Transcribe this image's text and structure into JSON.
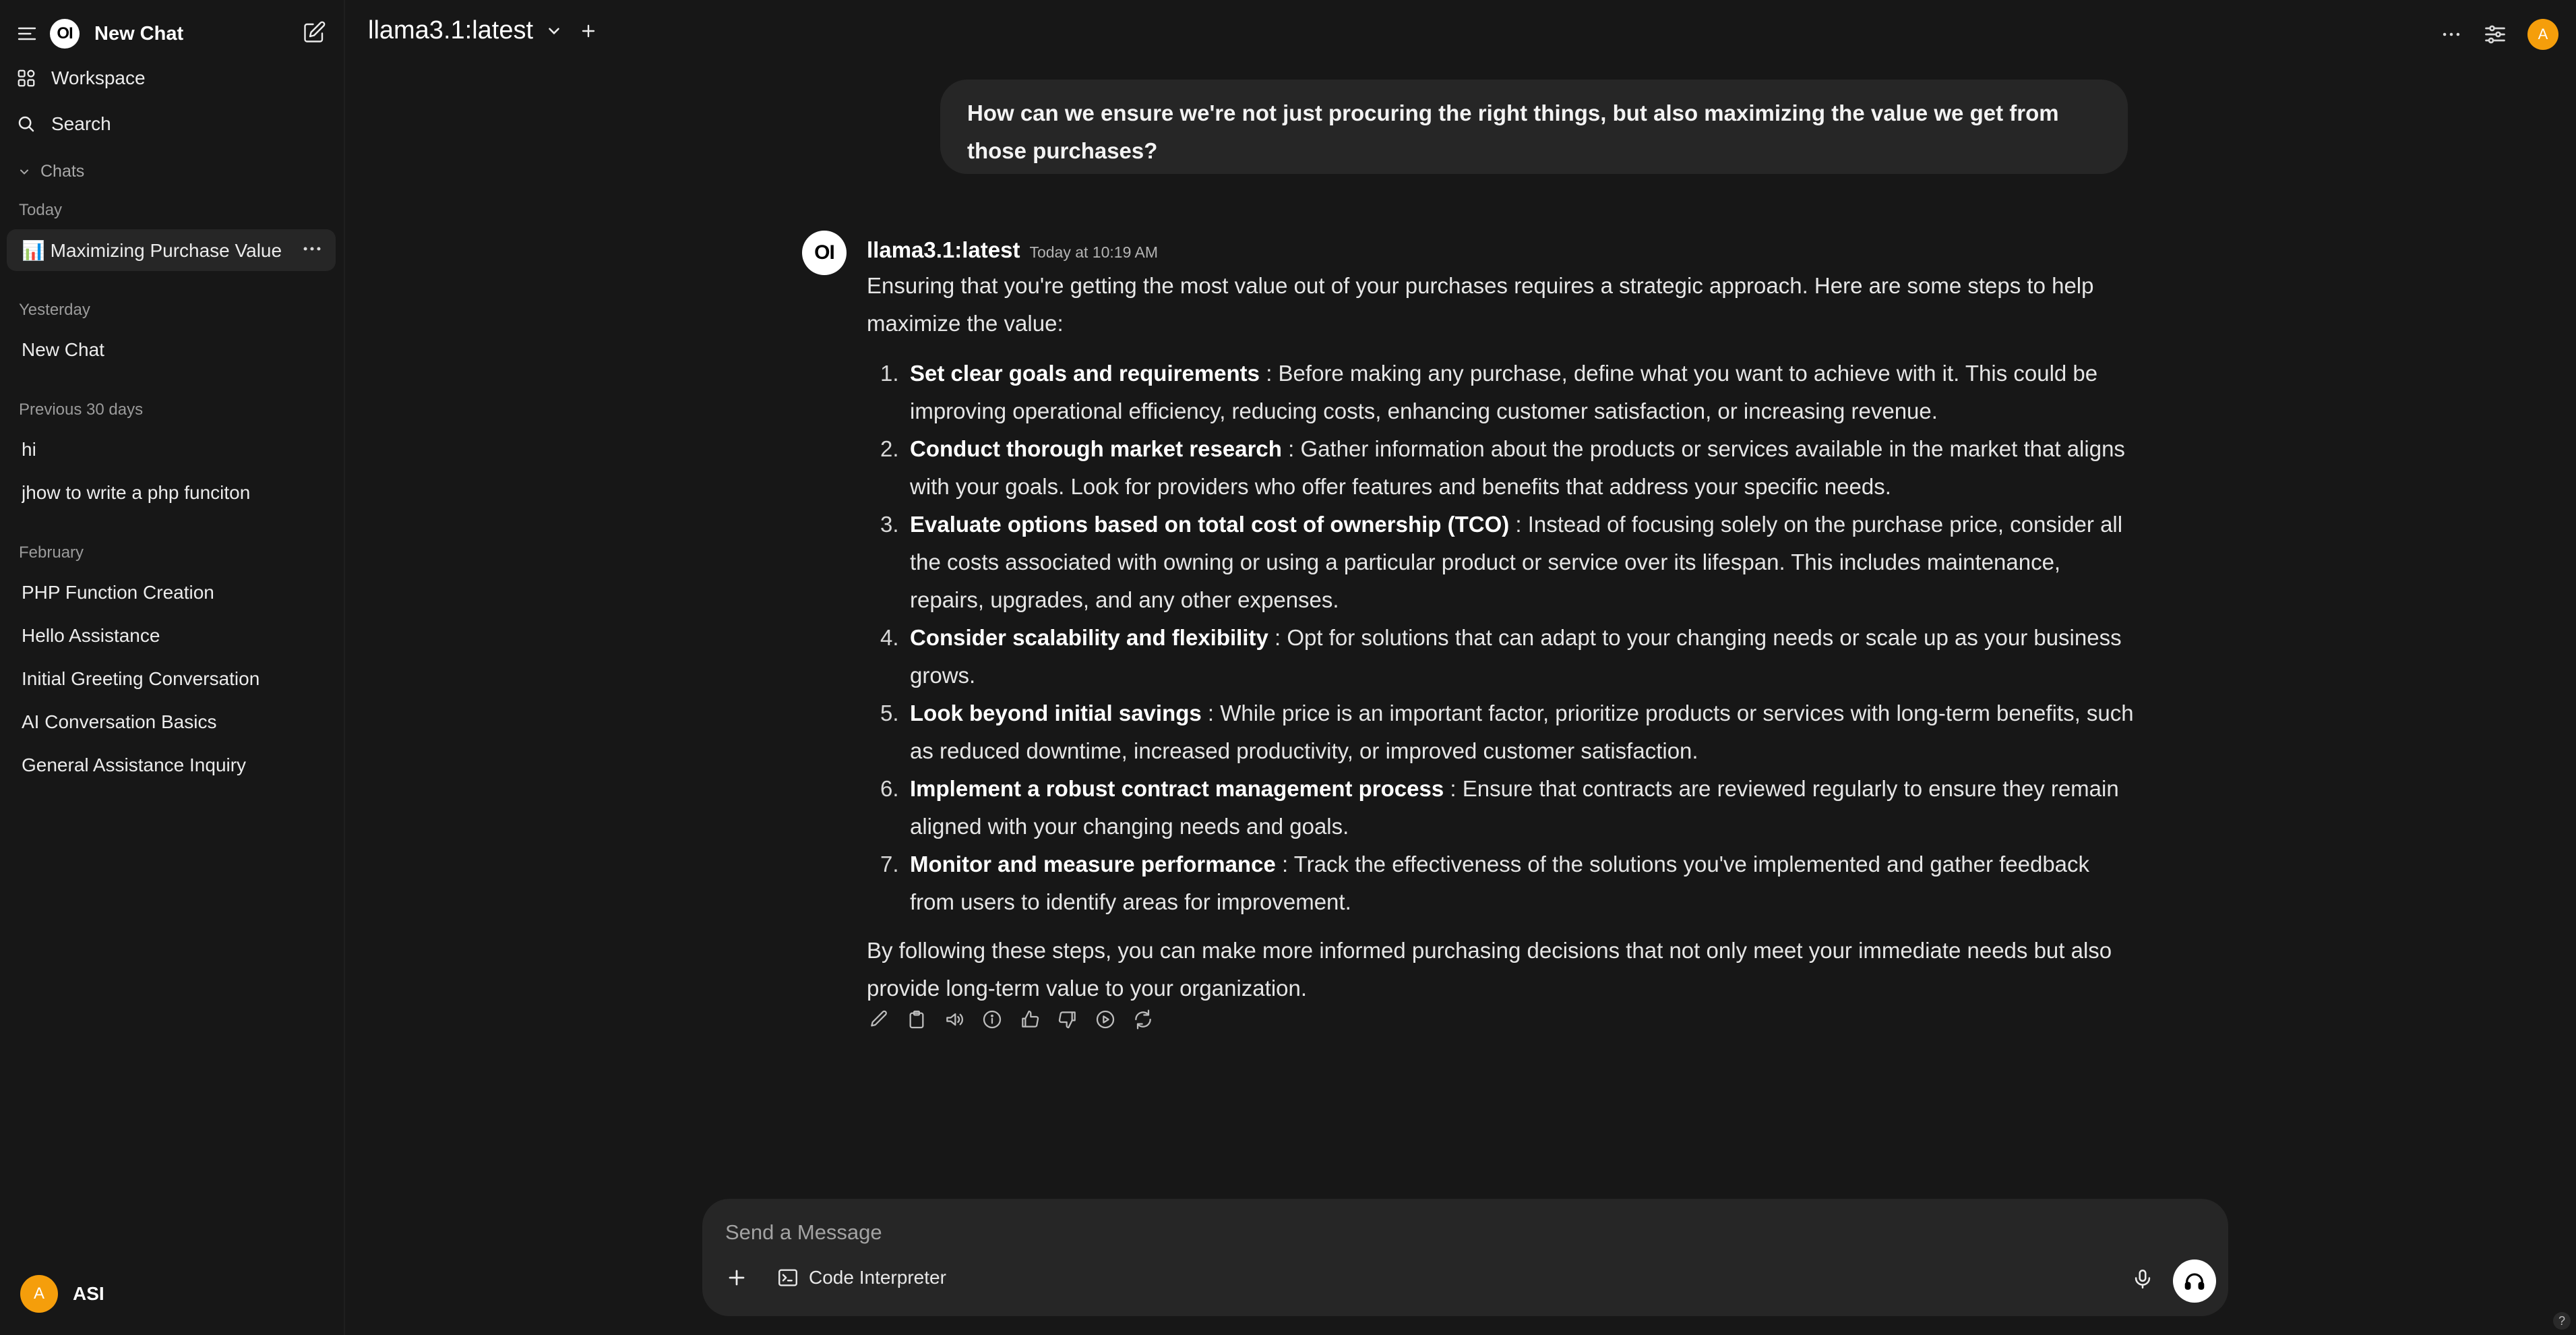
{
  "sidebar": {
    "new_chat_label": "New Chat",
    "workspace_label": "Workspace",
    "search_label": "Search",
    "chats_label": "Chats",
    "sections": {
      "today": "Today",
      "yesterday": "Yesterday",
      "previous_30": "Previous 30 days",
      "february": "February"
    },
    "today_items": [
      {
        "label": "📊 Maximizing Purchase Value"
      }
    ],
    "yesterday_items": [
      {
        "label": "New Chat"
      }
    ],
    "previous_30_items": [
      {
        "label": "hi"
      },
      {
        "label": "jhow to write a php funciton"
      }
    ],
    "february_items": [
      {
        "label": "PHP Function Creation"
      },
      {
        "label": "Hello Assistance"
      },
      {
        "label": "Initial Greeting Conversation"
      },
      {
        "label": "AI Conversation Basics"
      },
      {
        "label": "General Assistance Inquiry"
      }
    ],
    "user": {
      "initial": "A",
      "name": "ASI"
    },
    "brand_logo_text": "OI"
  },
  "header": {
    "model": "llama3.1:latest",
    "avatar_initial": "A"
  },
  "conversation": {
    "user_message": "How can we ensure we're not just procuring the right things, but also maximizing the value we get from those purchases?",
    "assistant": {
      "avatar_text": "OI",
      "model": "llama3.1:latest",
      "time": "Today at 10:19 AM",
      "intro": "Ensuring that you're getting the most value out of your purchases requires a strategic approach. Here are some steps to help maximize the value:",
      "steps": [
        {
          "num": "1.",
          "title": "Set clear goals and requirements",
          "text": " : Before making any purchase, define what you want to achieve with it. This could be improving operational efficiency, reducing costs, enhancing customer satisfaction, or increasing revenue."
        },
        {
          "num": "2.",
          "title": "Conduct thorough market research",
          "text": " : Gather information about the products or services available in the market that aligns with your goals. Look for providers who offer features and benefits that address your specific needs."
        },
        {
          "num": "3.",
          "title": "Evaluate options based on total cost of ownership (TCO)",
          "text": " : Instead of focusing solely on the purchase price, consider all the costs associated with owning or using a particular product or service over its lifespan. This includes maintenance, repairs, upgrades, and any other expenses."
        },
        {
          "num": "4.",
          "title": "Consider scalability and flexibility",
          "text": " : Opt for solutions that can adapt to your changing needs or scale up as your business grows."
        },
        {
          "num": "5.",
          "title": "Look beyond initial savings",
          "text": " : While price is an important factor, prioritize products or services with long-term benefits, such as reduced downtime, increased productivity, or improved customer satisfaction."
        },
        {
          "num": "6.",
          "title": "Implement a robust contract management process",
          "text": " : Ensure that contracts are reviewed regularly to ensure they remain aligned with your changing needs and goals."
        },
        {
          "num": "7.",
          "title": "Monitor and measure performance",
          "text": " : Track the effectiveness of the solutions you've implemented and gather feedback from users to identify areas for improvement."
        }
      ],
      "outro": "By following these steps, you can make more informed purchasing decisions that not only meet your immediate needs but also provide long-term value to your organization."
    }
  },
  "composer": {
    "placeholder": "Send a Message",
    "code_interpreter_label": "Code Interpreter"
  },
  "help_label": "?",
  "icons": {
    "menu": "hamburger-icon",
    "compose": "pencil-square-icon",
    "workspace": "grid-icon",
    "search": "search-icon",
    "chevron": "chevron-down-icon",
    "more": "ellipsis-icon",
    "controls": "sliders-icon",
    "actions": [
      "edit-icon",
      "copy-icon",
      "speaker-icon",
      "info-icon",
      "thumbs-up-icon",
      "thumbs-down-icon",
      "play-icon",
      "regenerate-icon"
    ],
    "plus": "plus-icon",
    "terminal": "terminal-icon",
    "mic": "microphone-icon",
    "headphones": "headphones-icon"
  },
  "colors": {
    "background": "#171717",
    "bubble": "#262626",
    "accent_avatar": "#f59e0b"
  }
}
